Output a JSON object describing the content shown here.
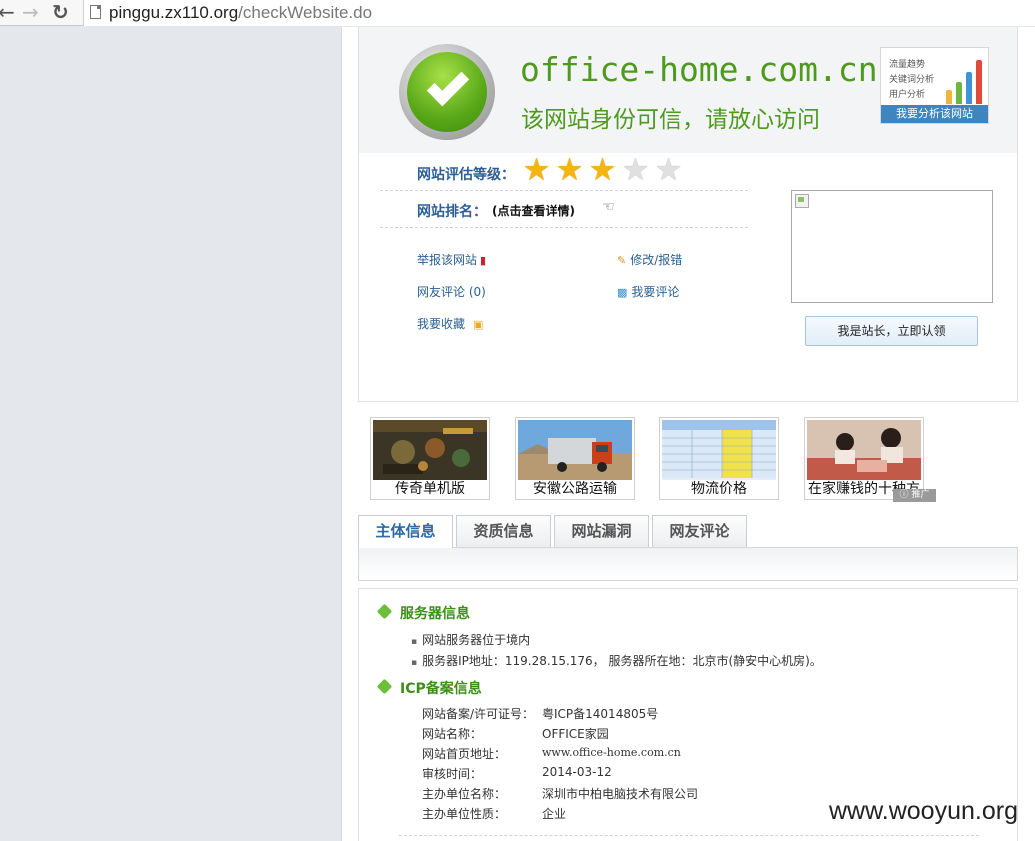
{
  "browser": {
    "url_host": "pinggu.zx110.org",
    "url_path": "/checkWebsite.do"
  },
  "banner": {
    "domain": "office-home.com.cn",
    "trust_text": "该网站身份可信，请放心访问",
    "analysis_lines": [
      "流量趋势",
      "关键词分析",
      "用户分析"
    ],
    "analysis_button": "我要分析该网站",
    "bar_colors": [
      "#f0b53a",
      "#6cb740",
      "#3f93d8",
      "#e24a3a"
    ]
  },
  "rating": {
    "label": "网站评估等级：",
    "stars_filled": 3,
    "stars_total": 5
  },
  "rank": {
    "label": "网站排名：",
    "link": "(点击查看详情)"
  },
  "actions": {
    "report": "举报该网站",
    "edit": "修改/报错",
    "comments": "网友评论 (0)",
    "write_comment": "我要评论",
    "favorite": "我要收藏"
  },
  "claim_button": "我是站长，立即认领",
  "ads": {
    "items": [
      "传奇单机版",
      "安徽公路运输",
      "物流价格",
      "在家赚钱的十种方"
    ],
    "tag": "推广"
  },
  "tabs": [
    "主体信息",
    "资质信息",
    "网站漏洞",
    "网友评论"
  ],
  "server": {
    "heading": "服务器信息",
    "items": [
      "网站服务器位于境内",
      "服务器IP地址：119.28.15.176， 服务器所在地：北京市(静安中心机房)。"
    ]
  },
  "icp": {
    "heading": "ICP备案信息",
    "rows": [
      {
        "key": "网站备案/许可证号：",
        "value": "粤ICP备14014805号"
      },
      {
        "key": "网站名称：",
        "value": "OFFICE家园"
      },
      {
        "key": "网站首页地址：",
        "value": "www.office-home.com.cn"
      },
      {
        "key": "审核时间：",
        "value": "2014-03-12"
      },
      {
        "key": "主办单位名称：",
        "value": "深圳市中柏电脑技术有限公司"
      },
      {
        "key": "主办单位性质：",
        "value": "企业"
      }
    ]
  },
  "watermark": "www.wooyun.org"
}
